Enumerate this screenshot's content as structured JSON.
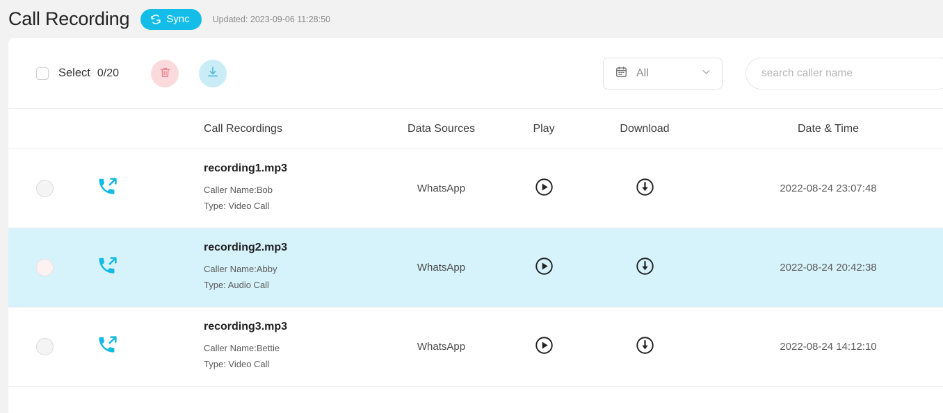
{
  "header": {
    "title": "Call Recording",
    "sync_label": "Sync",
    "sync_icon": "refresh-icon",
    "updated_text": "Updated: 2023-09-06 11:28:50"
  },
  "toolbar": {
    "select_label": "Select",
    "select_count": "0/20",
    "delete_icon": "trash-icon",
    "download_icon": "download-icon",
    "date_filter": {
      "icon": "calendar-icon",
      "value": "All",
      "chevron": "chevron-down-icon"
    },
    "search": {
      "value": "",
      "placeholder": "search caller name"
    }
  },
  "table": {
    "columns": [
      {
        "key": "name",
        "label": "Call Recordings"
      },
      {
        "key": "source",
        "label": "Data Sources"
      },
      {
        "key": "play",
        "label": "Play"
      },
      {
        "key": "download",
        "label": "Download"
      },
      {
        "key": "date",
        "label": "Date & Time"
      }
    ],
    "rows": [
      {
        "call_icon": "outgoing-call-icon",
        "file_name": "recording1.mp3",
        "caller": "Caller Name:Bob",
        "type": "Type: Video Call",
        "source": "WhatsApp",
        "play_icon": "play-circle-icon",
        "download_icon": "download-circle-icon",
        "date": "2022-08-24 23:07:48",
        "highlighted": false
      },
      {
        "call_icon": "outgoing-call-icon",
        "file_name": "recording2.mp3",
        "caller": "Caller Name:Abby",
        "type": "Type: Audio Call",
        "source": "WhatsApp",
        "play_icon": "play-circle-icon",
        "download_icon": "download-circle-icon",
        "date": "2022-08-24 20:42:38",
        "highlighted": true
      },
      {
        "call_icon": "outgoing-call-icon",
        "file_name": "recording3.mp3",
        "caller": "Caller Name:Bettie",
        "type": "Type: Video Call",
        "source": "WhatsApp",
        "play_icon": "play-circle-icon",
        "download_icon": "download-circle-icon",
        "date": "2022-08-24 14:12:10",
        "highlighted": false
      }
    ]
  },
  "colors": {
    "accent": "#14bde8",
    "highlight_row": "#d6f2fa",
    "delete_bg": "#fadadd",
    "download_bg": "#c9ecf7",
    "page_bg": "#f2f2f2"
  }
}
